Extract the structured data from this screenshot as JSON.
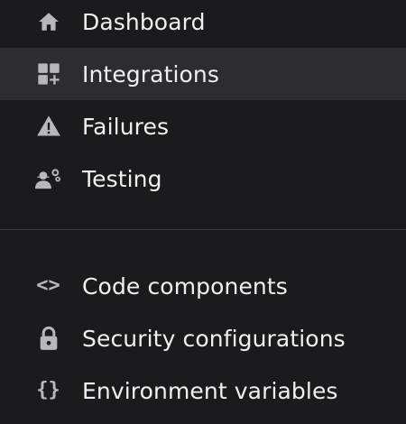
{
  "nav": {
    "primary": [
      {
        "label": "Dashboard",
        "icon": "home-icon"
      },
      {
        "label": "Integrations",
        "icon": "integrations-icon",
        "active": true
      },
      {
        "label": "Failures",
        "icon": "warning-icon"
      },
      {
        "label": "Testing",
        "icon": "testing-icon"
      }
    ],
    "secondary": [
      {
        "label": "Code components",
        "icon": "code-icon",
        "glyph": "<>"
      },
      {
        "label": "Security configurations",
        "icon": "lock-icon"
      },
      {
        "label": "Environment variables",
        "icon": "braces-icon",
        "glyph": "{}"
      }
    ]
  },
  "colors": {
    "background": "#1b1b1d",
    "active_background": "#2c2c31",
    "text": "#f0f0f0",
    "icon": "#b8b8bc",
    "divider": "#3a3a3e"
  }
}
